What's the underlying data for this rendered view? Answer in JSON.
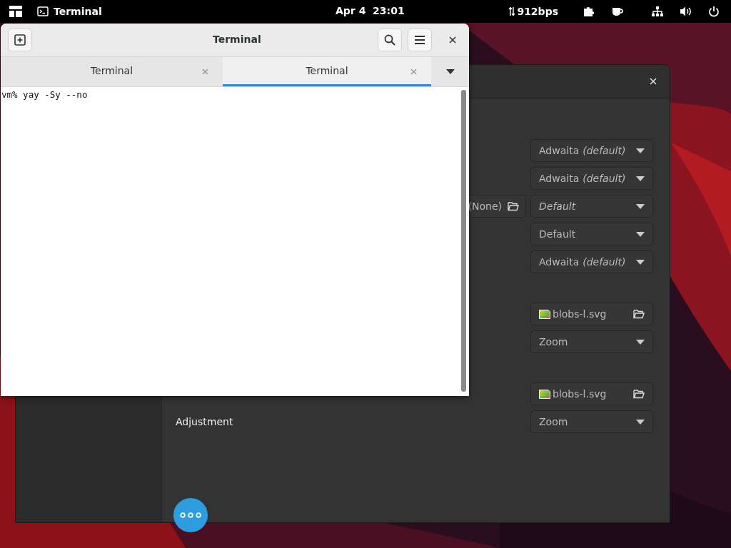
{
  "top_bar": {
    "app_name": "Terminal",
    "clock": "Apr 4  23:01",
    "network_speed": "912bps"
  },
  "settings_window": {
    "sections": [
      {
        "rows": [
          {
            "kind": "dropdown",
            "label": "",
            "value": "Adwaita",
            "note": "(default)",
            "italic": false
          },
          {
            "kind": "dropdown",
            "label": "",
            "value": "Adwaita",
            "note": "(default)",
            "italic": false
          },
          {
            "kind": "dropdown",
            "label": "",
            "value": "Default",
            "note": "",
            "italic": true,
            "file_button": "(None)"
          },
          {
            "kind": "dropdown",
            "label": "",
            "value": "Default",
            "note": "",
            "italic": false
          },
          {
            "kind": "dropdown",
            "label": "",
            "value": "Adwaita",
            "note": "(default)",
            "italic": false
          }
        ]
      },
      {
        "rows": [
          {
            "kind": "file",
            "label": "",
            "value": "blobs-l.svg"
          },
          {
            "kind": "dropdown",
            "label": "",
            "value": "Zoom",
            "note": "",
            "italic": false
          }
        ]
      },
      {
        "rows": [
          {
            "kind": "file",
            "label": "",
            "value": "blobs-l.svg"
          },
          {
            "kind": "dropdown",
            "label": "Adjustment",
            "value": "Zoom",
            "note": "",
            "italic": false
          }
        ]
      }
    ]
  },
  "terminal_window": {
    "title": "Terminal",
    "tabs": [
      {
        "label": "Terminal",
        "selected": false
      },
      {
        "label": "Terminal",
        "selected": true
      }
    ],
    "lines": [
      "vm% yay -Sy --no"
    ]
  }
}
